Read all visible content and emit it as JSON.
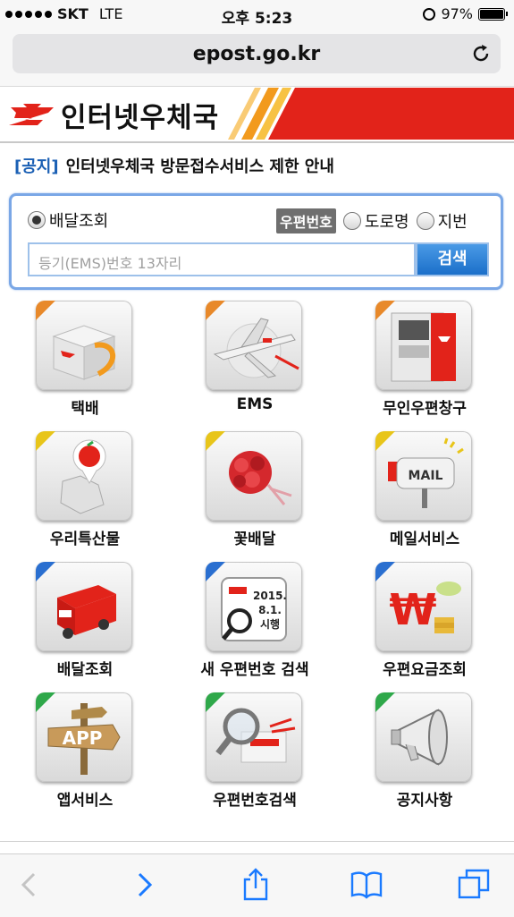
{
  "status": {
    "carrier": "SKT",
    "network": "LTE",
    "time": "오후 5:23",
    "battery": "97%"
  },
  "browser": {
    "url": "epost.go.kr"
  },
  "banner": {
    "title": "인터넷우체국"
  },
  "notice": {
    "tag": "[공지]",
    "text": "인터넷우체국 방문접수서비스 제한 안내"
  },
  "search": {
    "option_delivery": "배달조회",
    "zip_badge": "우편번호",
    "option_road": "도로명",
    "option_lot": "지번",
    "placeholder": "등기(EMS)번호 13자리",
    "button": "검색"
  },
  "services": [
    {
      "label": "택배",
      "icon": "parcel-box-icon",
      "corner": "#e8892a"
    },
    {
      "label": "EMS",
      "icon": "airplane-icon",
      "corner": "#e8892a"
    },
    {
      "label": "무인우편창구",
      "icon": "kiosk-icon",
      "corner": "#e8892a"
    },
    {
      "label": "우리특산물",
      "icon": "local-products-icon",
      "corner": "#e8c51a"
    },
    {
      "label": "꽃배달",
      "icon": "flower-bouquet-icon",
      "corner": "#e8c51a"
    },
    {
      "label": "메일서비스",
      "icon": "mailbox-icon",
      "corner": "#e8c51a"
    },
    {
      "label": "배달조회",
      "icon": "delivery-truck-icon",
      "corner": "#2a6fd0"
    },
    {
      "label": "새 우편번호 검색",
      "icon": "new-zipcode-icon",
      "corner": "#2a6fd0"
    },
    {
      "label": "우편요금조회",
      "icon": "postage-fee-icon",
      "corner": "#2a6fd0"
    },
    {
      "label": "앱서비스",
      "icon": "app-sign-icon",
      "corner": "#2fa84a"
    },
    {
      "label": "우편번호검색",
      "icon": "zipcode-search-icon",
      "corner": "#2fa84a"
    },
    {
      "label": "공지사항",
      "icon": "megaphone-icon",
      "corner": "#2fa84a"
    }
  ],
  "icons": {
    "parcel_text": "",
    "mail_text": "MAIL",
    "app_text": "APP",
    "zip_date": "2015. 8.1. 시행",
    "zip_date_line1": "2015.",
    "zip_date_line2": "8.1.",
    "zip_date_line3": "시행"
  },
  "colors": {
    "accent": "#1a5fb4",
    "brand_red": "#e2231a",
    "brand_orange": "#f29a1d"
  }
}
